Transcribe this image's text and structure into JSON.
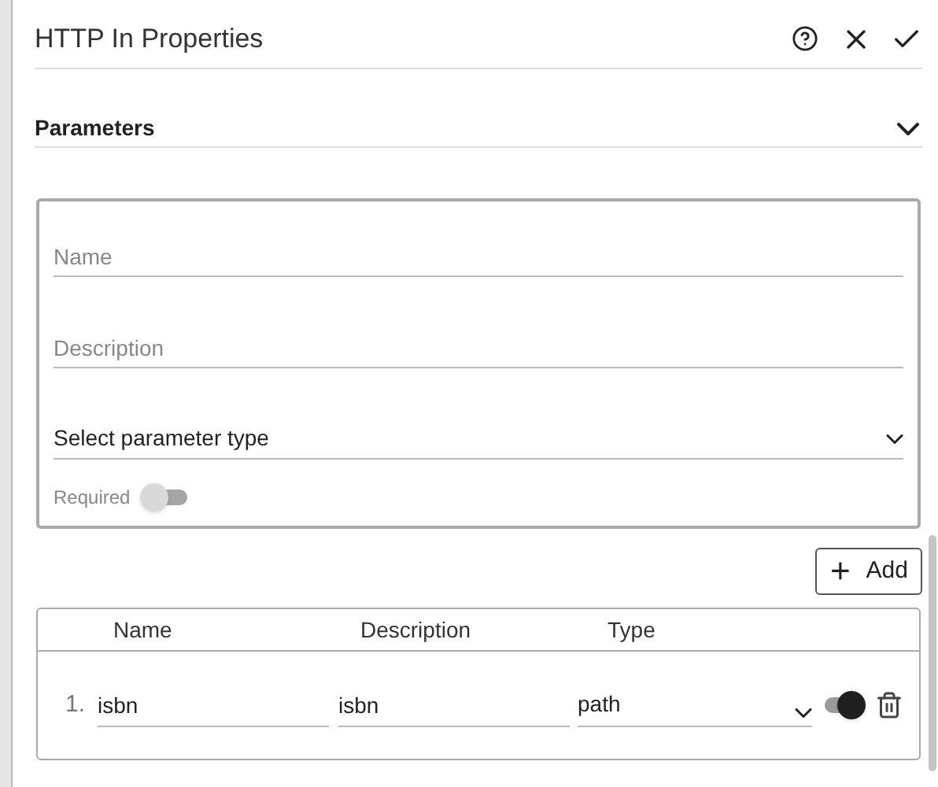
{
  "title": "HTTP In Properties",
  "section": {
    "title": "Parameters",
    "expanded": true
  },
  "form": {
    "name": {
      "placeholder": "Name"
    },
    "description": {
      "placeholder": "Description"
    },
    "type": {
      "placeholder": "Select parameter type"
    },
    "required": {
      "label": "Required",
      "on": false
    }
  },
  "add_button": {
    "icon": "+",
    "label": "Add"
  },
  "table": {
    "columns": [
      "Name",
      "Description",
      "Type"
    ],
    "rows": [
      {
        "index": "1.",
        "name": "isbn",
        "description": "isbn",
        "type": "path",
        "required": true
      }
    ]
  }
}
